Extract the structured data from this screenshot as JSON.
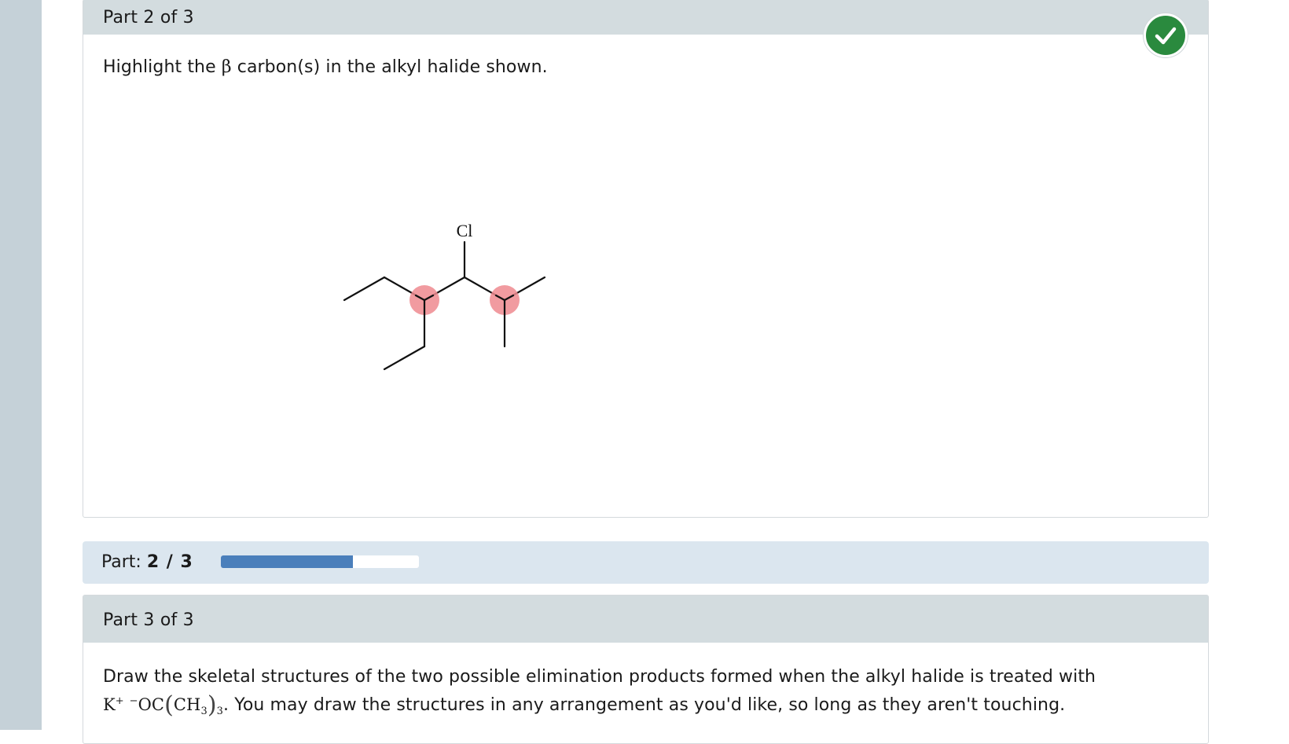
{
  "part2": {
    "header": "Part 2 of 3",
    "prompt_before": "Highlight the ",
    "prompt_symbol": "β",
    "prompt_after": " carbon(s) in the alkyl halide shown.",
    "molecule_label": "Cl",
    "status": "correct",
    "status_icon": "checkmark-icon"
  },
  "progress": {
    "label": "Part:",
    "current": "2 / 3",
    "fraction": 0.667,
    "fill_color": "#4a7fbb"
  },
  "part3": {
    "header": "Part 3 of 3",
    "line1": "Draw the skeletal structures of the two possible elimination products formed when the alkyl halide is treated with",
    "reagent": {
      "cation": "K",
      "cation_charge": "+",
      "anion_charge": "−",
      "anion_a": "OC",
      "group": "CH",
      "group_sub": "3",
      "outer_sub": "3"
    },
    "line2": ". You may draw the structures in any arrangement as you'd like, so long as they aren't touching."
  },
  "colors": {
    "highlight": "#ee8a8f",
    "check": "#2a8a3e",
    "header_bg": "#d3dcdf"
  }
}
